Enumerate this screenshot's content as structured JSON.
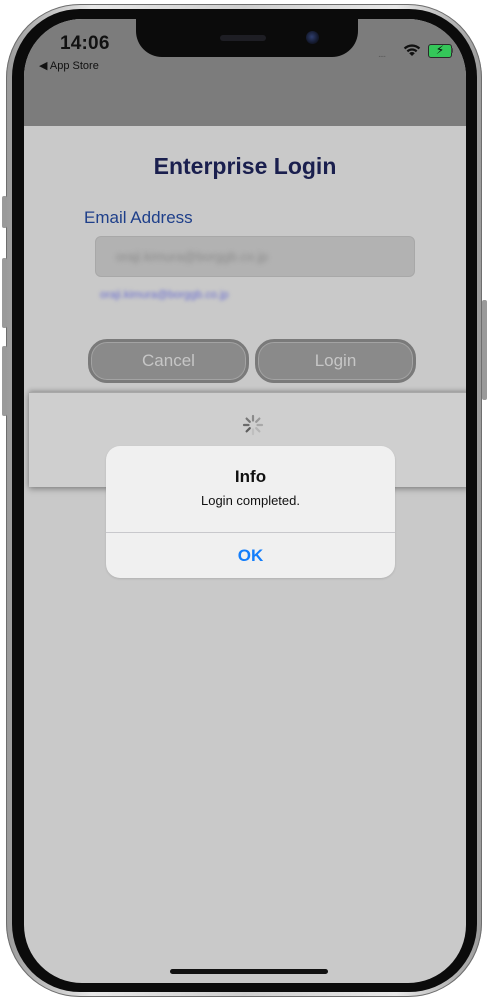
{
  "status_bar": {
    "time": "14:06",
    "back_app": "◀ App Store",
    "signal_dots": "....",
    "battery_color": "#34c759"
  },
  "login": {
    "title": "Enterprise Login",
    "email_label": "Email Address",
    "email_value": "oraji.kimura@borggb.co.jp",
    "email_hint": "oraji.kimura@borggb.co.jp",
    "cancel_label": "Cancel",
    "login_label": "Login"
  },
  "progress": {
    "spinner_icon": "activity-spinner-icon"
  },
  "alert": {
    "title": "Info",
    "message": "Login completed.",
    "ok_label": "OK",
    "ok_color": "#147efb"
  },
  "colors": {
    "title_color": "#1a1f4e",
    "label_color": "#1e3f8a",
    "overlay_gray": "#c9c9c9"
  }
}
